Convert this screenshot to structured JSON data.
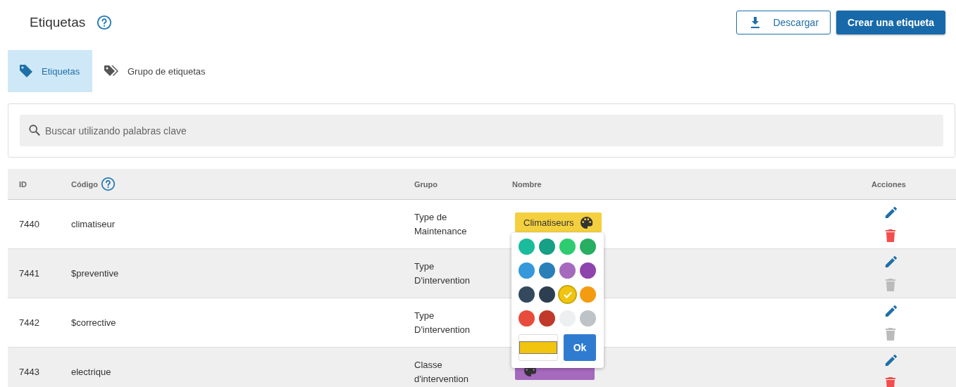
{
  "page": {
    "title": "Etiquetas"
  },
  "buttons": [
    {
      "kind": "download",
      "label": "Descargar"
    },
    {
      "kind": "primary",
      "label": "Crear una etiqueta"
    }
  ],
  "tabs": [
    {
      "label": "Etiquetas",
      "selected": true
    },
    {
      "label": "Grupo de etiquetas",
      "selected": false
    }
  ],
  "search": {
    "placeholder": "Buscar utilizando palabras clave"
  },
  "table": {
    "columns": [
      "ID",
      "Código",
      "Grupo",
      "Nombre",
      "Acciones"
    ],
    "rows": [
      {
        "id": "7440",
        "code": "climatiseur",
        "group": "Type de Maintenance",
        "tag": {
          "name": "Climatiseurs",
          "color": "#f4d03f"
        },
        "deletable": true
      },
      {
        "id": "7441",
        "code": "$preventive",
        "group": "Type D'intervention",
        "deletable": false
      },
      {
        "id": "7442",
        "code": "$corrective",
        "group": "Type D'intervention",
        "deletable": false
      },
      {
        "id": "7443",
        "code": "electrique",
        "group": "Classe d'intervention",
        "tag": {
          "color": "#a569bd"
        },
        "deletable": true
      }
    ]
  },
  "color_picker": {
    "swatches": [
      {
        "color": "#1abc9c",
        "selected": false
      },
      {
        "color": "#16a085",
        "selected": false
      },
      {
        "color": "#2ecc71",
        "selected": false
      },
      {
        "color": "#27ae60",
        "selected": false
      },
      {
        "color": "#3498db",
        "selected": false
      },
      {
        "color": "#2980b9",
        "selected": false
      },
      {
        "color": "#a569bd",
        "selected": false
      },
      {
        "color": "#8e44ad",
        "selected": false
      },
      {
        "color": "#34495e",
        "selected": false
      },
      {
        "color": "#2c3e50",
        "selected": false
      },
      {
        "color": "#f1c40f",
        "selected": true
      },
      {
        "color": "#f39c12",
        "selected": false
      },
      {
        "color": "#e74c3c",
        "selected": false
      },
      {
        "color": "#c0392b",
        "selected": false
      },
      {
        "color": "#ecf0f1",
        "selected": false
      },
      {
        "color": "#bdc3c7",
        "selected": false
      }
    ],
    "ok_label": "Ok"
  }
}
